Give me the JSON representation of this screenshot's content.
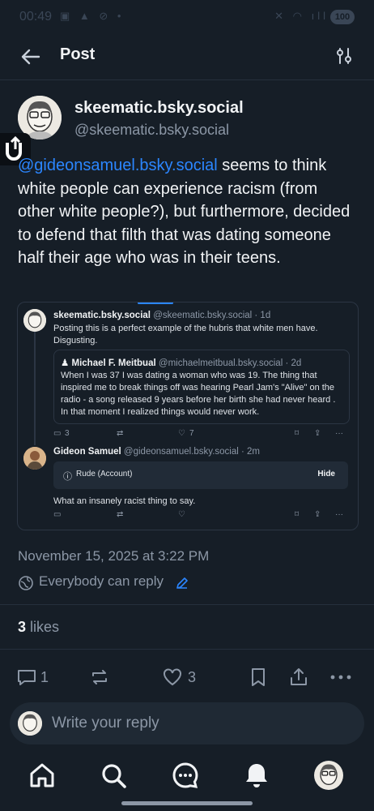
{
  "status_bar": {
    "time": "00:49",
    "battery": "100"
  },
  "header": {
    "title": "Post"
  },
  "post": {
    "author": {
      "display_name": "skeematic.bsky.social",
      "handle": "@skeematic.bsky.social"
    },
    "text": {
      "mention": "@gideonsamuel.bsky.social",
      "body_1": " seems to think white people can experience racism (from other white people?), but furthermore, decided to defend that filth that was dating someone half their age who was in their teens."
    },
    "date": "November 15, 2025 at 3:22 PM",
    "reply_setting": "Everybody can reply",
    "likes_count": "3",
    "likes_label": "likes",
    "reply_count": "1",
    "like_count": "3"
  },
  "embed": {
    "first": {
      "name": "skeematic.bsky.social",
      "meta": "@skeematic.bsky.social · 1d",
      "text": "Posting this is a perfect example of the hubris that white men have. Disgusting.",
      "reply_count": "3",
      "like_count": "7"
    },
    "quote": {
      "name": "Michael F. Meitbual",
      "meta": "@michaelmeitbual.bsky.social · 2d",
      "text": "When I was 37 I was dating a woman who was 19. The thing that inspired me to break things off was hearing Pearl Jam's \"Alive\" on the radio - a song released 9 years before her birth she had never heard . In that moment I realized things would never work."
    },
    "second": {
      "name": "Gideon Samuel",
      "meta": "@gideonsamuel.bsky.social · 2m",
      "warning": "Rude (Account)",
      "hide": "Hide",
      "text": "What an insanely racist thing to say."
    }
  },
  "reply_box": {
    "placeholder": "Write your reply"
  },
  "colors": {
    "background": "#161e27",
    "accent": "#2b86ff",
    "muted": "#8c97a6",
    "text": "#f1f3f5"
  }
}
